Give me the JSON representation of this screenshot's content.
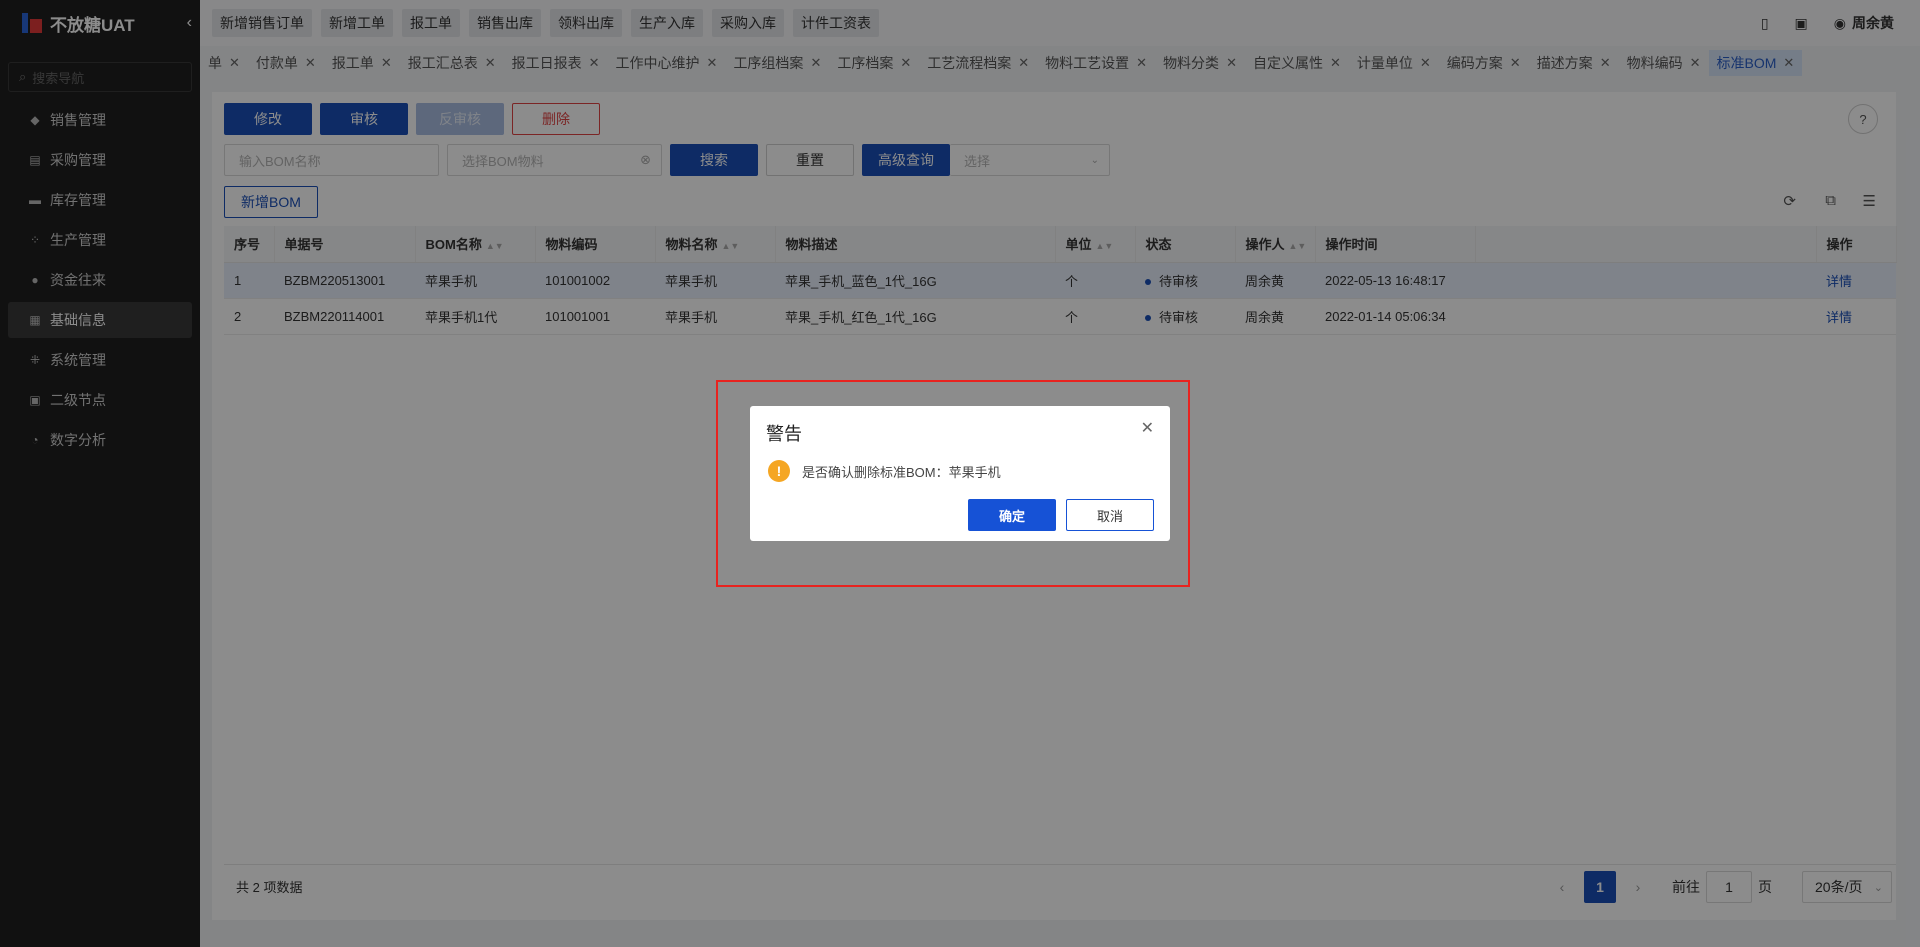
{
  "app": {
    "name": "不放糖UAT"
  },
  "sidebar": {
    "search_placeholder": "搜索导航",
    "items": [
      {
        "label": "销售管理",
        "icon": "tag-icon"
      },
      {
        "label": "采购管理",
        "icon": "cart-icon"
      },
      {
        "label": "库存管理",
        "icon": "inventory-icon"
      },
      {
        "label": "生产管理",
        "icon": "production-icon"
      },
      {
        "label": "资金往来",
        "icon": "money-icon"
      },
      {
        "label": "基础信息",
        "icon": "grid-icon",
        "active": true
      },
      {
        "label": "系统管理",
        "icon": "settings-icon"
      },
      {
        "label": "二级节点",
        "icon": "document-icon"
      },
      {
        "label": "数字分析",
        "icon": "pie-chart-icon"
      }
    ]
  },
  "topbar": {
    "quick_actions": [
      "新增销售订单",
      "新增工单",
      "报工单",
      "销售出库",
      "领料出库",
      "生产入库",
      "采购入库",
      "计件工资表"
    ],
    "user": "周余黄"
  },
  "tabs": [
    {
      "label": "单"
    },
    {
      "label": "付款单"
    },
    {
      "label": "报工单"
    },
    {
      "label": "报工汇总表"
    },
    {
      "label": "报工日报表"
    },
    {
      "label": "工作中心维护"
    },
    {
      "label": "工序组档案"
    },
    {
      "label": "工序档案"
    },
    {
      "label": "工艺流程档案"
    },
    {
      "label": "物料工艺设置"
    },
    {
      "label": "物料分类"
    },
    {
      "label": "自定义属性"
    },
    {
      "label": "计量单位"
    },
    {
      "label": "编码方案"
    },
    {
      "label": "描述方案"
    },
    {
      "label": "物料编码"
    },
    {
      "label": "标准BOM",
      "active": true
    }
  ],
  "toolbar": {
    "edit": "修改",
    "audit": "审核",
    "unaudit": "反审核",
    "delete": "删除",
    "name_placeholder": "输入BOM名称",
    "material_placeholder": "选择BOM物料",
    "search": "搜索",
    "reset": "重置",
    "advanced": "高级查询",
    "select_placeholder": "选择",
    "add_bom": "新增BOM"
  },
  "table": {
    "columns": [
      "序号",
      "单据号",
      "BOM名称",
      "物料编码",
      "物料名称",
      "物料描述",
      "单位",
      "状态",
      "操作人",
      "操作时间",
      "",
      "操作"
    ],
    "rows": [
      [
        "1",
        "BZBM220513001",
        "苹果手机",
        "101001002",
        "苹果手机",
        "苹果_手机_蓝色_1代_16G",
        "个",
        "待审核",
        "周余黄",
        "2022-05-13 16:48:17",
        "",
        "详情"
      ],
      [
        "2",
        "BZBM220114001",
        "苹果手机1代",
        "101001001",
        "苹果手机",
        "苹果_手机_红色_1代_16G",
        "个",
        "待审核",
        "周余黄",
        "2022-01-14 05:06:34",
        "",
        "详情"
      ]
    ]
  },
  "footer": {
    "total": "共 2 项数据",
    "page": "1",
    "goto_label": "前往",
    "goto_value": "1",
    "page_unit": "页",
    "page_size": "20条/页"
  },
  "dialog": {
    "title": "警告",
    "message": "是否确认删除标准BOM：苹果手机",
    "ok": "确定",
    "cancel": "取消"
  },
  "colors": {
    "primary": "#1a4fb8",
    "danger": "#e04444",
    "warning": "#f5a623",
    "highlight": "#e8231f"
  }
}
